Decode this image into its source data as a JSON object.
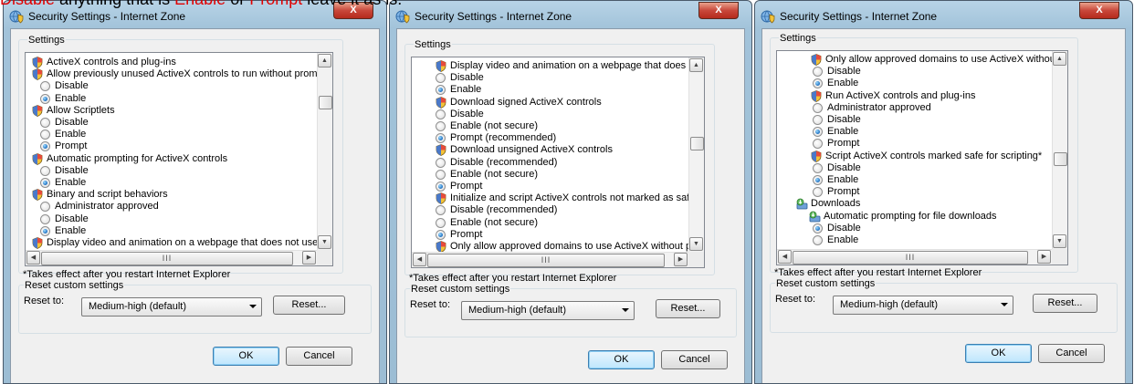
{
  "caption": {
    "part1": "Disable",
    "part2": " anything that is ",
    "part3": "Enable",
    "part4": " or ",
    "part5": "Prompt",
    "part6": " leave it as is."
  },
  "colors": {
    "caption_highlight": "#e00000",
    "titlebar": "#a9c8de",
    "close_button": "#c8473a",
    "selected_radio": "#1d6fc1"
  },
  "icons": {
    "window": "security-globe-icon",
    "setting": "shield-icon",
    "downloads": "downloads-icon"
  },
  "windows": [
    {
      "title": "Security Settings - Internet Zone",
      "close_label": "X",
      "settings_label": "Settings",
      "tree": [
        {
          "kind": "item",
          "icon": "shield",
          "label": "ActiveX controls and plug-ins"
        },
        {
          "kind": "item",
          "icon": "shield",
          "label": "Allow previously unused ActiveX controls to run without prom"
        },
        {
          "kind": "option",
          "label": "Disable",
          "selected": false
        },
        {
          "kind": "option",
          "label": "Enable",
          "selected": true
        },
        {
          "kind": "item",
          "icon": "shield",
          "label": "Allow Scriptlets"
        },
        {
          "kind": "option",
          "label": "Disable",
          "selected": false
        },
        {
          "kind": "option",
          "label": "Enable",
          "selected": false
        },
        {
          "kind": "option",
          "label": "Prompt",
          "selected": true
        },
        {
          "kind": "item",
          "icon": "shield",
          "label": "Automatic prompting for ActiveX controls"
        },
        {
          "kind": "option",
          "label": "Disable",
          "selected": false
        },
        {
          "kind": "option",
          "label": "Enable",
          "selected": true
        },
        {
          "kind": "item",
          "icon": "shield",
          "label": "Binary and script behaviors"
        },
        {
          "kind": "option",
          "label": "Administrator approved",
          "selected": false
        },
        {
          "kind": "option",
          "label": "Disable",
          "selected": false
        },
        {
          "kind": "option",
          "label": "Enable",
          "selected": true
        },
        {
          "kind": "item",
          "icon": "shield",
          "label": "Display video and animation on a webpage that does not use"
        }
      ],
      "scroll_position": 0.18,
      "hscroll_label": "III",
      "note": "*Takes effect after you restart Internet Explorer",
      "reset_group_label": "Reset custom settings",
      "reset_to_label": "Reset to:",
      "reset_value": "Medium-high (default)",
      "reset_button": "Reset...",
      "ok": "OK",
      "cancel": "Cancel"
    },
    {
      "title": "Security Settings - Internet Zone",
      "close_label": "X",
      "settings_label": "Settings",
      "tree": [
        {
          "kind": "item",
          "icon": "shield",
          "label": "Display video and animation on a webpage that does not use"
        },
        {
          "kind": "option",
          "label": "Disable",
          "selected": false
        },
        {
          "kind": "option",
          "label": "Enable",
          "selected": true
        },
        {
          "kind": "item",
          "icon": "shield",
          "label": "Download signed ActiveX controls"
        },
        {
          "kind": "option",
          "label": "Disable",
          "selected": false
        },
        {
          "kind": "option",
          "label": "Enable (not secure)",
          "selected": false
        },
        {
          "kind": "option",
          "label": "Prompt (recommended)",
          "selected": true
        },
        {
          "kind": "item",
          "icon": "shield",
          "label": "Download unsigned ActiveX controls"
        },
        {
          "kind": "option",
          "label": "Disable (recommended)",
          "selected": false
        },
        {
          "kind": "option",
          "label": "Enable (not secure)",
          "selected": false
        },
        {
          "kind": "option",
          "label": "Prompt",
          "selected": true
        },
        {
          "kind": "item",
          "icon": "shield",
          "label": "Initialize and script ActiveX controls not marked as safe for sc"
        },
        {
          "kind": "option",
          "label": "Disable (recommended)",
          "selected": false
        },
        {
          "kind": "option",
          "label": "Enable (not secure)",
          "selected": false
        },
        {
          "kind": "option",
          "label": "Prompt",
          "selected": true
        },
        {
          "kind": "item",
          "icon": "shield",
          "label": "Only allow approved domains to use ActiveX without prompt"
        }
      ],
      "scroll_position": 0.42,
      "hscroll_label": "III",
      "note": "*Takes effect after you restart Internet Explorer",
      "reset_group_label": "Reset custom settings",
      "reset_to_label": "Reset to:",
      "reset_value": "Medium-high (default)",
      "reset_button": "Reset...",
      "ok": "OK",
      "cancel": "Cancel"
    },
    {
      "title": "Security Settings - Internet Zone",
      "close_label": "X",
      "settings_label": "Settings",
      "tree": [
        {
          "kind": "item",
          "icon": "shield",
          "label": "Only allow approved domains to use ActiveX without prompt"
        },
        {
          "kind": "option",
          "label": "Disable",
          "selected": false
        },
        {
          "kind": "option",
          "label": "Enable",
          "selected": true
        },
        {
          "kind": "item",
          "icon": "shield",
          "label": "Run ActiveX controls and plug-ins"
        },
        {
          "kind": "option",
          "label": "Administrator approved",
          "selected": false
        },
        {
          "kind": "option",
          "label": "Disable",
          "selected": false
        },
        {
          "kind": "option",
          "label": "Enable",
          "selected": true
        },
        {
          "kind": "option",
          "label": "Prompt",
          "selected": false
        },
        {
          "kind": "item",
          "icon": "shield",
          "label": "Script ActiveX controls marked safe for scripting*"
        },
        {
          "kind": "option",
          "label": "Disable",
          "selected": false
        },
        {
          "kind": "option",
          "label": "Enable",
          "selected": true
        },
        {
          "kind": "option",
          "label": "Prompt",
          "selected": false
        },
        {
          "kind": "category",
          "icon": "downloads",
          "label": "Downloads"
        },
        {
          "kind": "item",
          "icon": "downloads",
          "label": "Automatic prompting for file downloads"
        },
        {
          "kind": "option",
          "label": "Disable",
          "selected": true
        },
        {
          "kind": "option",
          "label": "Enable",
          "selected": false
        }
      ],
      "scroll_position": 0.55,
      "hscroll_label": "III",
      "note": "*Takes effect after you restart Internet Explorer",
      "reset_group_label": "Reset custom settings",
      "reset_to_label": "Reset to:",
      "reset_value": "Medium-high (default)",
      "reset_button": "Reset...",
      "ok": "OK",
      "cancel": "Cancel"
    }
  ]
}
